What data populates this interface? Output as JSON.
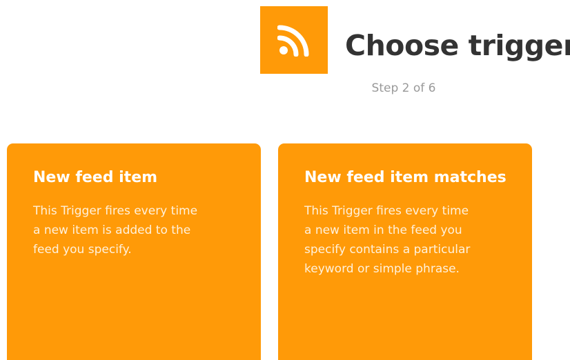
{
  "header": {
    "service_icon": "rss-feed-icon",
    "title": "Choose trigger",
    "step": "Step 2 of 6"
  },
  "colors": {
    "brand": "#ff9a08",
    "title_text": "#333333",
    "step_text": "#999999"
  },
  "triggers": [
    {
      "title": "New feed item",
      "description": "This Trigger fires every time\na new item is added to the\nfeed you specify."
    },
    {
      "title": "New feed item matches",
      "description": "This Trigger fires every time\na new item in the feed you\nspecify contains a particular\nkeyword or simple phrase."
    }
  ]
}
